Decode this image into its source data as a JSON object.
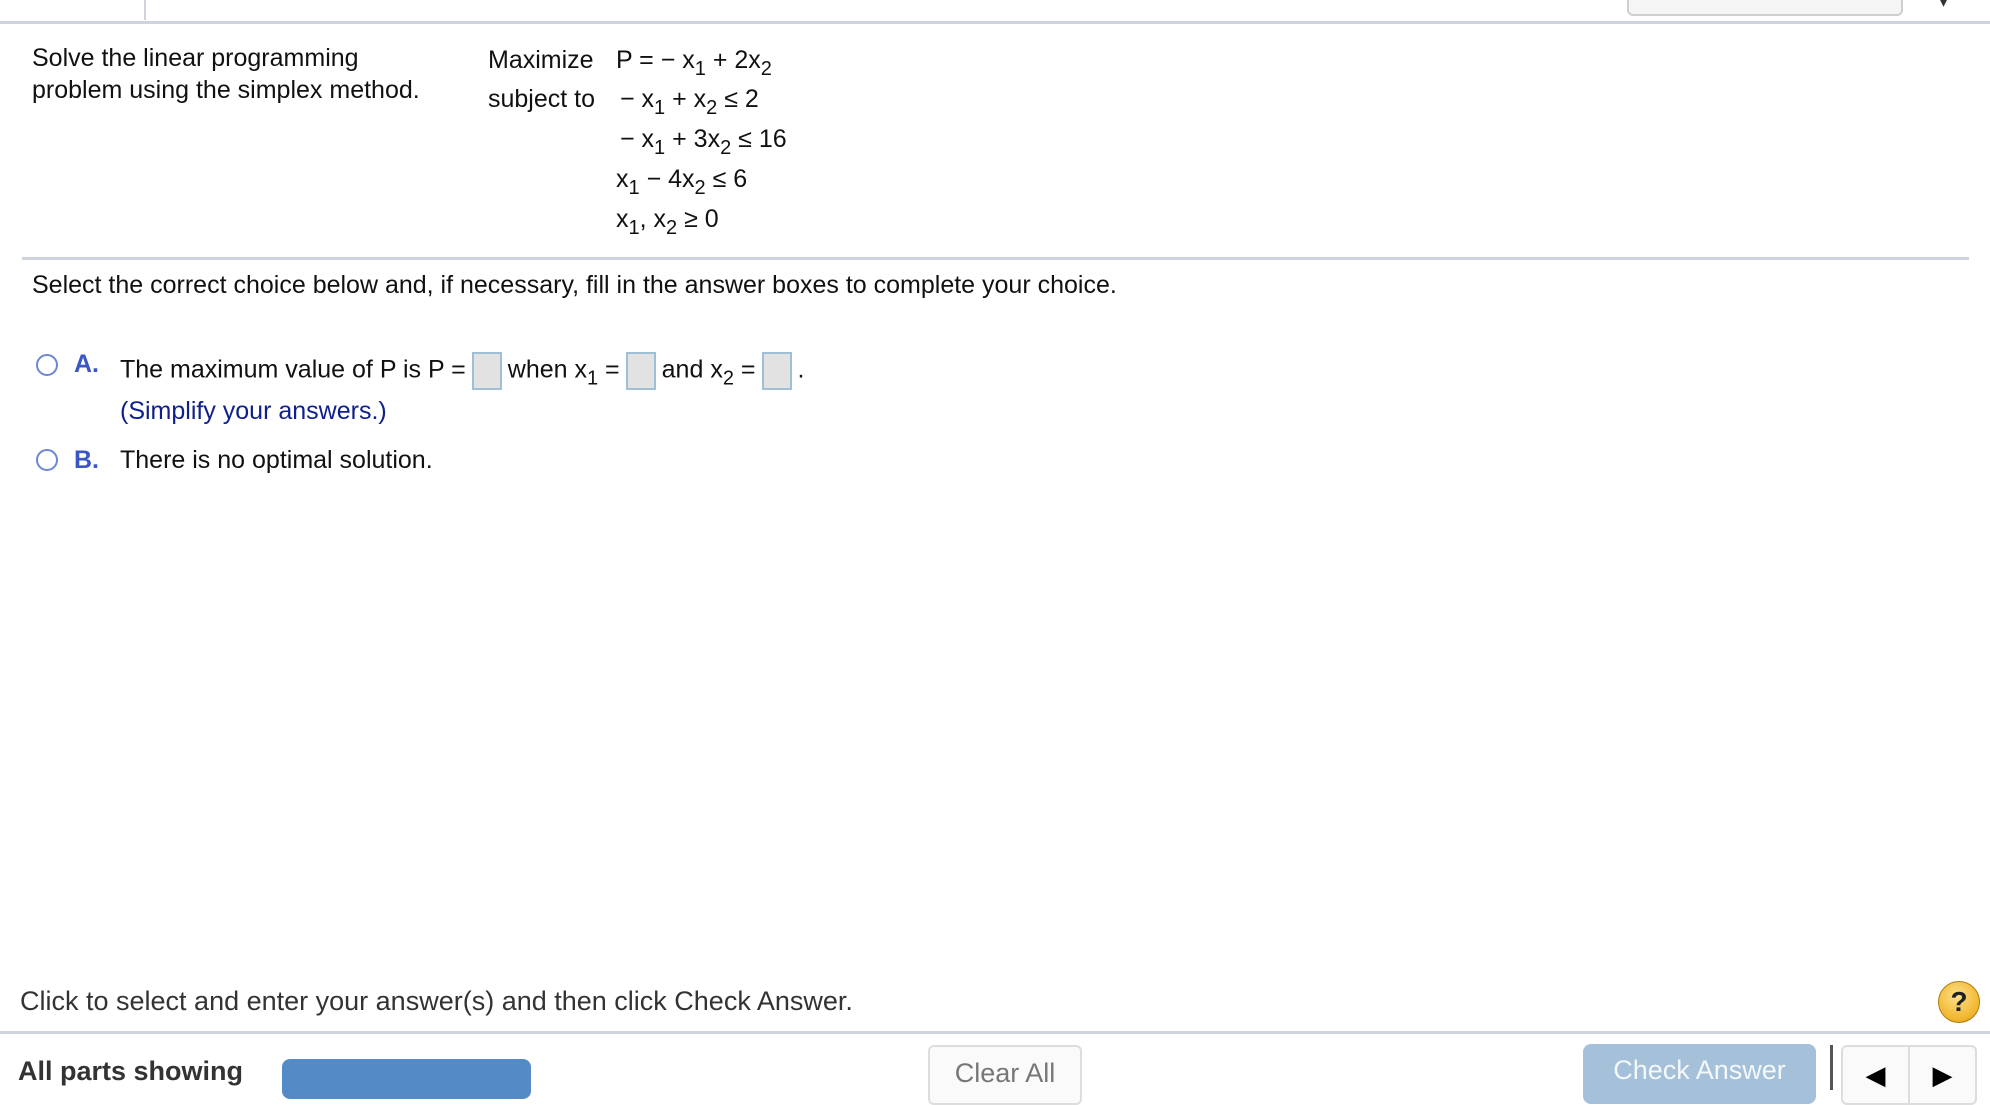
{
  "problem": {
    "prompt": "Solve the linear programming problem using the simplex method.",
    "maximize_label": "Maximize",
    "subject_to_label": "subject to",
    "objective": {
      "lhs": "P = − x",
      "s1": "1",
      "mid": " + 2x",
      "s2": "2"
    },
    "constraints": [
      {
        "a": "− x",
        "s1": "1",
        "b": " + x",
        "s2": "2",
        "c": " ≤ 2"
      },
      {
        "a": "− x",
        "s1": "1",
        "b": " + 3x",
        "s2": "2",
        "c": " ≤ 16"
      },
      {
        "a": "x",
        "s1": "1",
        "b": " − 4x",
        "s2": "2",
        "c": " ≤ 6"
      },
      {
        "a": "x",
        "s1": "1",
        "b": ", x",
        "s2": "2",
        "c": " ≥ 0"
      }
    ]
  },
  "instruction": "Select the correct choice below and, if necessary, fill in the answer boxes to complete your choice.",
  "options": {
    "a": {
      "letter": "A.",
      "text_before": "The maximum value of P is P =",
      "text_when": "when x",
      "sub1": "1",
      "eq": " =",
      "text_and": "and x",
      "sub2": "2",
      "eq2": " =",
      "period": ".",
      "hint": "(Simplify your answers.)",
      "answers": {
        "P": "",
        "x1": "",
        "x2": ""
      }
    },
    "b": {
      "letter": "B.",
      "text": "There is no optimal solution."
    }
  },
  "footer": {
    "hint": "Click to select and enter your answer(s) and then click Check Answer.",
    "help_icon": "?",
    "all_parts": "All parts showing",
    "clear_all": "Clear All",
    "check_answer": "Check Answer",
    "prev_icon": "◀",
    "next_icon": "▶"
  },
  "colors": {
    "accent": "#3a57c4",
    "progress_blue": "#548bc6",
    "check_answer_disabled": "#a5c0d9",
    "hint_blue": "#10208a"
  }
}
